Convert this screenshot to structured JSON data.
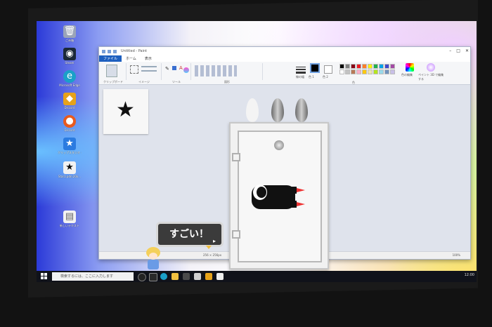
{
  "desktop_icons": [
    {
      "name": "recycle-bin",
      "label": "ごみ箱",
      "color": "#9aa4b8",
      "glyph": "🗑"
    },
    {
      "name": "steam",
      "label": "Steam",
      "color": "#1b2838",
      "glyph": "◉"
    },
    {
      "name": "edge",
      "label": "Microsoft Edge",
      "color": "#1aa0c8",
      "glyph": "e"
    },
    {
      "name": "app-yellow",
      "label": "Discord",
      "color": "#e6a21a",
      "glyph": "◆"
    },
    {
      "name": "app-orange",
      "label": "Discord",
      "color": "#e85a1e",
      "glyph": "●"
    },
    {
      "name": "star-app",
      "label": "クリップスタジオ ペイント",
      "color": "#2b7be0",
      "glyph": "★"
    },
    {
      "name": "star-file",
      "label": "Star1.pdn.20x...",
      "color": "#f2f2f2",
      "glyph": "★"
    },
    {
      "name": "text-file",
      "label": "新しいテキスト",
      "color": "#f2f2f2",
      "glyph": "▤"
    }
  ],
  "paint": {
    "title": "Untitled - Paint",
    "tabs": [
      "ファイル",
      "ホーム",
      "表示"
    ],
    "groups": [
      "クリップボード",
      "イメージ",
      "ツール",
      "図形",
      "色"
    ],
    "size_label": "線の幅",
    "color1_label": "色 1",
    "color2_label": "色 2",
    "edit_colors": "色の編集",
    "paint3d": "ペイント 3D で編集する",
    "dims": "256 × 256px",
    "zoom": "100%"
  },
  "palette_colors": [
    "#000000",
    "#7f7f7f",
    "#880015",
    "#ed1c24",
    "#ff7f27",
    "#fff200",
    "#22b14c",
    "#00a2e8",
    "#3f48cc",
    "#a349a4",
    "#ffffff",
    "#c3c3c3",
    "#b97a57",
    "#ffaec9",
    "#ffc90e",
    "#efe4b0",
    "#b5e61d",
    "#99d9ea",
    "#7092be",
    "#c8bfe7"
  ],
  "taskbar": {
    "search_placeholder": "検索するには、ここに入力します",
    "clock": "12:00"
  },
  "bubble": {
    "text": "すごい！",
    "arrow": "▸"
  },
  "colors": {
    "accent": "#1d5fbf",
    "bubble_bg": "#3b3b3b",
    "fridge": "#f1f1f1"
  }
}
